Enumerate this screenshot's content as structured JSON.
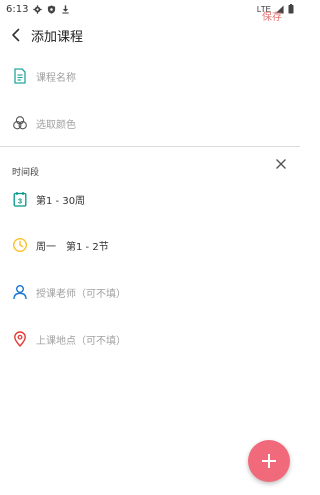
{
  "status_bar": {
    "time": "6:13",
    "network": "LTE"
  },
  "toolbar": {
    "title": "添加课程",
    "save_label": "保存"
  },
  "form": {
    "course_name_placeholder": "课程名称",
    "color_placeholder": "选取颜色"
  },
  "time_section": {
    "title": "时间段",
    "weeks_value": "第1 - 30周",
    "schedule_value": "周一　第1 - 2节",
    "teacher_placeholder": "授课老师（可不填）",
    "location_placeholder": "上课地点（可不填）"
  },
  "colors": {
    "accent": "#e57373",
    "fab": "#f06a7b",
    "teal_icon": "#26a69a",
    "weeks_icon": "#009688",
    "clock_icon": "#fbc02d",
    "person_icon": "#1976d2",
    "location_icon": "#e53935"
  },
  "icons": {
    "back": "chevron-left",
    "course_name": "document",
    "color": "three-circles",
    "close": "close-x",
    "weeks": "calendar",
    "schedule": "clock",
    "teacher": "person",
    "location": "map-pin",
    "fab": "plus"
  }
}
